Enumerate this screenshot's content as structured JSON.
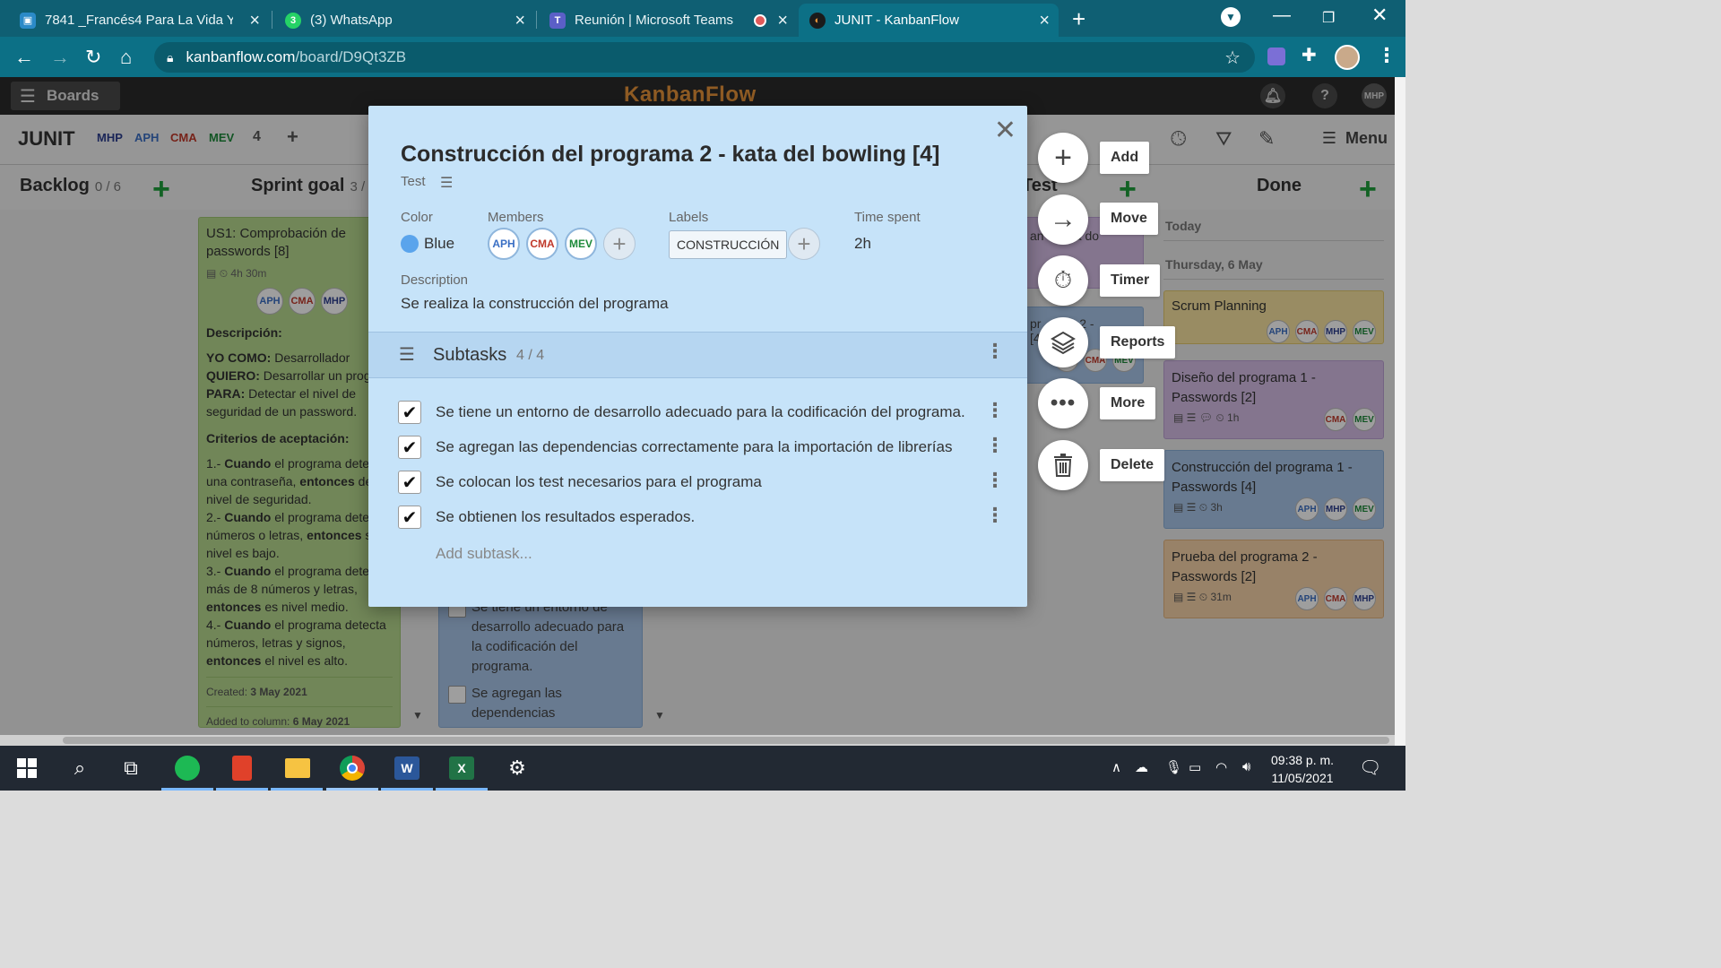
{
  "browser": {
    "tabs": [
      {
        "title": "7841 _Francés4 Para La Vida Y Tr",
        "fav_color": "#2b8ac8"
      },
      {
        "title": "(3) WhatsApp",
        "fav_color": "#25d366"
      },
      {
        "title": "Reunión | Microsoft Teams",
        "fav_color": "#5b5fc7"
      },
      {
        "title": "JUNIT - KanbanFlow",
        "fav_color": "#e8953a"
      }
    ],
    "url_host": "kanbanflow.com",
    "url_path": "/board/D9Qt3ZB"
  },
  "app": {
    "boards_label": "Boards",
    "logo": "KanbanFlow",
    "user_badge": "MHP",
    "board_title": "JUNIT",
    "board_members": [
      "MHP",
      "APH",
      "CMA",
      "MEV"
    ],
    "member_count": "4",
    "menu_label": "Menu",
    "columns": [
      {
        "name": "Backlog",
        "count": "0 / 6"
      },
      {
        "name": "Sprint goal",
        "count": "3 / 3"
      },
      {
        "name": "Test",
        "count": ""
      },
      {
        "name": "Done",
        "count": ""
      }
    ],
    "sprint_card": {
      "title": "US1: Comprobación de passwords [8]",
      "time": "4h 30m",
      "members": [
        "APH",
        "CMA",
        "MHP"
      ],
      "desc_heading": "Descripción:",
      "yo_como_k": "YO COMO:",
      "yo_como_v": " Desarrollador",
      "quiero_k": "QUIERO:",
      "quiero_v": " Desarrollar un progr",
      "para_k": "PARA:",
      "para_v": " Detectar el nivel de seguridad de un password.",
      "criteria_heading": "Criterios de aceptación:",
      "c1a": "1.- ",
      "c1b": "Cuando",
      "c1c": " el programa detec una contraseña, ",
      "c1d": "entonces",
      "c1e": " def su nivel de seguridad.",
      "c2a": "2.- ",
      "c2b": "Cuando",
      "c2c": " el programa detec números o letras, ",
      "c2d": "entonces",
      "c2e": " su nivel es bajo.",
      "c3a": "3.- ",
      "c3b": "Cuando",
      "c3c": " el programa detec más de 8 números y letras, ",
      "c3d": "entonces",
      "c3e": " es nivel medio.",
      "c4a": "4.- ",
      "c4b": "Cuando",
      "c4c": " el programa detecta números, letras y signos, ",
      "c4d": "entonces",
      "c4e": " el nivel es alto.",
      "created_k": "Created: ",
      "created_v": "3 May 2021",
      "added_k": "Added to column: ",
      "added_v": "6 May 2021"
    },
    "blue_card_subtasks": [
      "Se tiene un entorno de desarrollo adecuado para la codificación del programa.",
      "Se agregan las dependencias"
    ],
    "test_col_text": [
      "an",
      "sta do",
      "pr",
      "a 2 -",
      "[4"
    ],
    "test_col_members": [
      "APH",
      "CMA",
      "MEV"
    ],
    "done": {
      "today": "Today",
      "date_label": "Thursday, 6 May",
      "cards": [
        {
          "title": "Scrum Planning",
          "members": [
            "APH",
            "CMA",
            "MHP",
            "MEV"
          ],
          "time": ""
        },
        {
          "title": "Diseño del programa 1 - Passwords [2]",
          "members": [
            "CMA",
            "MEV"
          ],
          "time": "1h"
        },
        {
          "title": "Construcción del programa 1 - Passwords [4]",
          "members": [
            "APH",
            "MHP",
            "MEV"
          ],
          "time": "3h"
        },
        {
          "title": "Prueba del programa 2 - Passwords [2]",
          "members": [
            "APH",
            "CMA",
            "MHP"
          ],
          "time": "31m"
        }
      ]
    }
  },
  "modal": {
    "title": "Construcción del programa 2 - kata del bowling [4]",
    "column": "Test",
    "color_label": "Color",
    "color_value": "Blue",
    "color_hex": "#5aa4ec",
    "members_label": "Members",
    "members": [
      "APH",
      "CMA",
      "MEV"
    ],
    "labels_label": "Labels",
    "label_chip": "CONSTRUCCIÓN",
    "time_label": "Time spent",
    "time_value": "2h",
    "desc_label": "Description",
    "desc_text": "Se realiza la construcción del programa",
    "subtasks_title": "Subtasks",
    "subtasks_count": "4 / 4",
    "subtasks": [
      {
        "text": "Se tiene un entorno de desarrollo adecuado para la codificación del programa.",
        "done": true
      },
      {
        "text": "Se agregan las dependencias correctamente para la importación de librerías",
        "done": true
      },
      {
        "text": "Se colocan los test necesarios para el programa",
        "done": true
      },
      {
        "text": "Se obtienen los resultados esperados.",
        "done": true
      }
    ],
    "add_subtask_placeholder": "Add subtask..."
  },
  "actions": [
    {
      "label": "Add",
      "icon": "plus-icon"
    },
    {
      "label": "Move",
      "icon": "arrow-right-icon"
    },
    {
      "label": "Timer",
      "icon": "stopwatch-icon"
    },
    {
      "label": "Reports",
      "icon": "layers-icon"
    },
    {
      "label": "More",
      "icon": "ellipsis-icon"
    },
    {
      "label": "Delete",
      "icon": "trash-icon"
    }
  ],
  "taskbar": {
    "time": "09:38 p. m.",
    "date": "11/05/2021"
  }
}
